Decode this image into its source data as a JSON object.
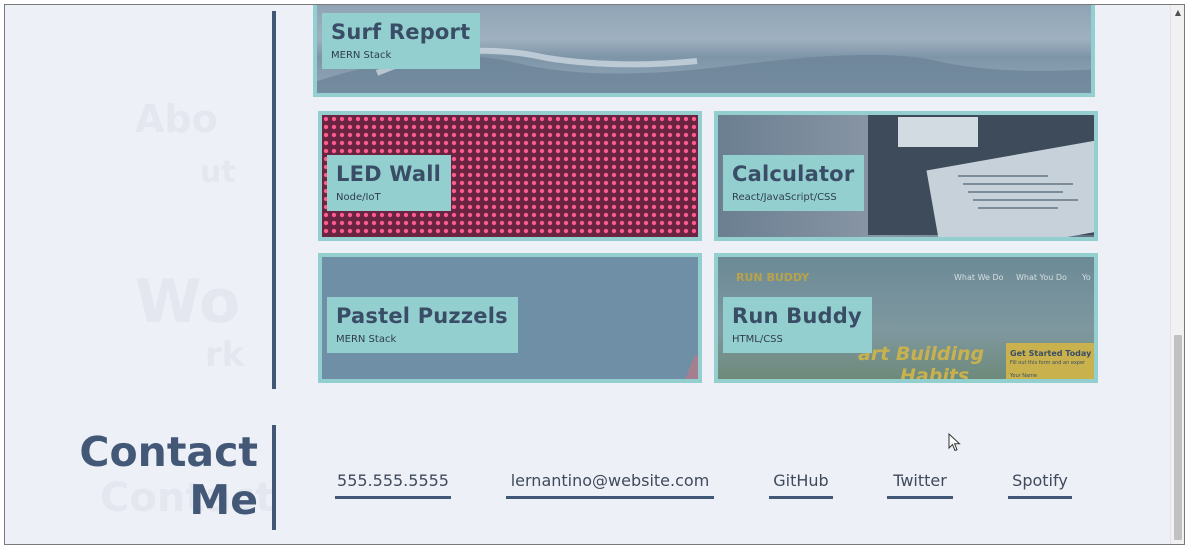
{
  "projects": [
    {
      "title": "Surf Report",
      "tech": "MERN Stack"
    },
    {
      "title": "LED Wall",
      "tech": "Node/IoT"
    },
    {
      "title": "Calculator",
      "tech": "React/JavaScript/CSS"
    },
    {
      "title": "Pastel Puzzels",
      "tech": "MERN Stack"
    },
    {
      "title": "Run Buddy",
      "tech": "HTML/CSS"
    }
  ],
  "run_buddy_preview": {
    "brand": "RUN BUDDY",
    "nav": [
      "What We Do",
      "What You Do",
      "Yo"
    ],
    "tagline_1": "art Building",
    "tagline_2": "Habits",
    "cta_title": "Get Started Today",
    "cta_sub": "Fill out this form and an exper",
    "cta_field": "Your Name"
  },
  "contact": {
    "heading_line1": "Contact",
    "heading_line2": "Me",
    "links": [
      "555.555.5555",
      "lernantino@website.com",
      "GitHub",
      "Twitter",
      "Spotify"
    ]
  },
  "colors": {
    "accent": "#93cfcf",
    "heading": "#435877",
    "background": "#eef0f7"
  }
}
